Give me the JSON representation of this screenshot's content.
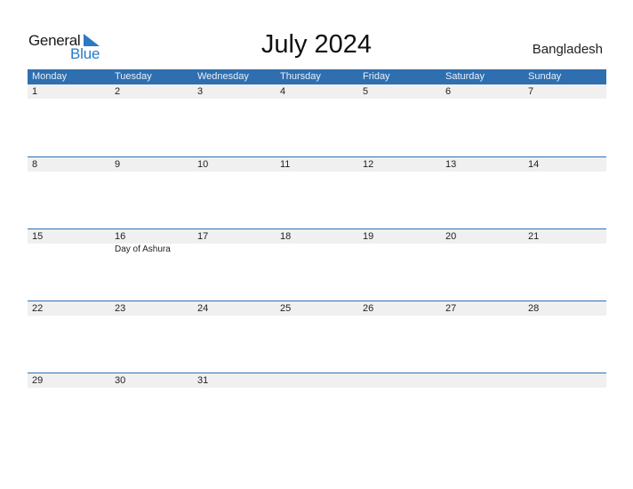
{
  "logo": {
    "word1": "General",
    "word2": "Blue",
    "accent_color": "#2a7ac4"
  },
  "title": "July 2024",
  "country": "Bangladesh",
  "colors": {
    "header_bg": "#2f6fb0",
    "day_band": "#f0f0f0"
  },
  "weekdays": [
    "Monday",
    "Tuesday",
    "Wednesday",
    "Thursday",
    "Friday",
    "Saturday",
    "Sunday"
  ],
  "weeks": [
    {
      "days": [
        "1",
        "2",
        "3",
        "4",
        "5",
        "6",
        "7"
      ],
      "events": [
        "",
        "",
        "",
        "",
        "",
        "",
        ""
      ]
    },
    {
      "days": [
        "8",
        "9",
        "10",
        "11",
        "12",
        "13",
        "14"
      ],
      "events": [
        "",
        "",
        "",
        "",
        "",
        "",
        ""
      ]
    },
    {
      "days": [
        "15",
        "16",
        "17",
        "18",
        "19",
        "20",
        "21"
      ],
      "events": [
        "",
        "Day of Ashura",
        "",
        "",
        "",
        "",
        ""
      ]
    },
    {
      "days": [
        "22",
        "23",
        "24",
        "25",
        "26",
        "27",
        "28"
      ],
      "events": [
        "",
        "",
        "",
        "",
        "",
        "",
        ""
      ]
    },
    {
      "days": [
        "29",
        "30",
        "31",
        "",
        "",
        "",
        ""
      ],
      "events": [
        "",
        "",
        "",
        "",
        "",
        "",
        ""
      ]
    }
  ]
}
